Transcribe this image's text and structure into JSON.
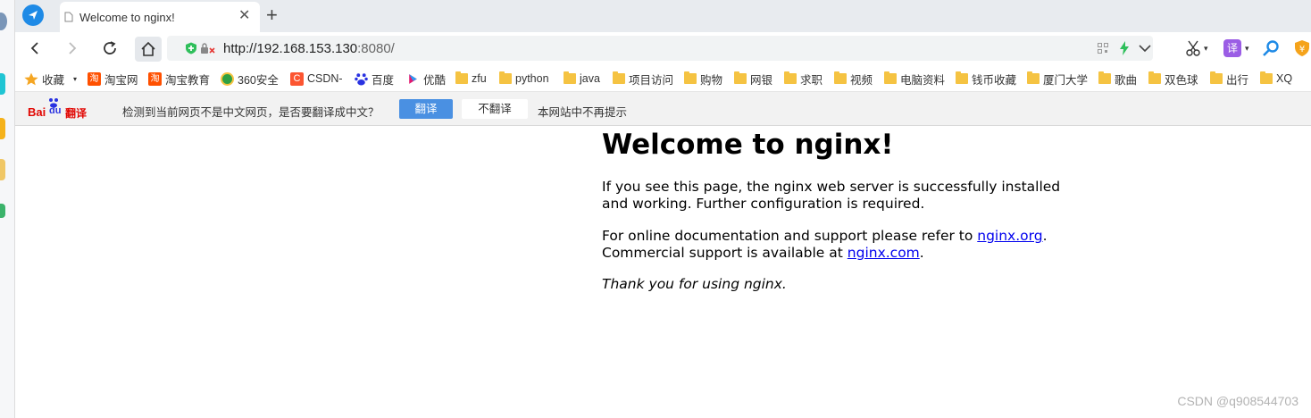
{
  "browser": {
    "tab": {
      "title": "Welcome to nginx!"
    },
    "address": {
      "url_host": "http://192.168.153.130",
      "url_port": ":8080/"
    },
    "bookmarks": [
      {
        "label": "收藏",
        "icon": "star-icon"
      },
      {
        "label": "淘宝网",
        "icon": "taobao-icon"
      },
      {
        "label": "淘宝教育",
        "icon": "taobao-icon"
      },
      {
        "label": "360安全",
        "icon": "360-icon"
      },
      {
        "label": "CSDN-",
        "icon": "csdn-icon"
      },
      {
        "label": "百度",
        "icon": "baidu-icon"
      },
      {
        "label": "优酷",
        "icon": "youku-icon"
      },
      {
        "label": "zfu",
        "icon": "folder-icon"
      },
      {
        "label": "python",
        "icon": "folder-icon"
      },
      {
        "label": "java",
        "icon": "folder-icon"
      },
      {
        "label": "项目访问",
        "icon": "folder-icon"
      },
      {
        "label": "购物",
        "icon": "folder-icon"
      },
      {
        "label": "网银",
        "icon": "folder-icon"
      },
      {
        "label": "求职",
        "icon": "folder-icon"
      },
      {
        "label": "视频",
        "icon": "folder-icon"
      },
      {
        "label": "电脑资料",
        "icon": "folder-icon"
      },
      {
        "label": "钱币收藏",
        "icon": "folder-icon"
      },
      {
        "label": "厦门大学",
        "icon": "folder-icon"
      },
      {
        "label": "歌曲",
        "icon": "folder-icon"
      },
      {
        "label": "双色球",
        "icon": "folder-icon"
      },
      {
        "label": "出行",
        "icon": "folder-icon"
      },
      {
        "label": "XQ",
        "icon": "folder-icon"
      }
    ],
    "translate": {
      "brand_left": "Bai",
      "brand_du": "du",
      "brand_right": "翻译",
      "message": "检测到当前网页不是中文网页，是否要翻译成中文？",
      "translate_button": "翻译",
      "no_translate_button": "不翻译",
      "never_label": "本网站中不再提示"
    },
    "toolbar_extension_label": "译"
  },
  "page": {
    "heading": "Welcome to nginx!",
    "para1": "If you see this page, the nginx web server is successfully installed and working. Further configuration is required.",
    "para2_prefix": "For online documentation and support please refer to ",
    "link_org": "nginx.org",
    "para2_mid": ".",
    "para2_line2_prefix": "Commercial support is available at ",
    "link_com": "nginx.com",
    "para2_end": ".",
    "para3": "Thank you for using nginx."
  },
  "watermark": "CSDN @q908544703",
  "colors": {
    "accent": "#1e8ae6",
    "translate_button": "#4a90e2",
    "link": "#0000ee",
    "folder": "#f5c342"
  }
}
